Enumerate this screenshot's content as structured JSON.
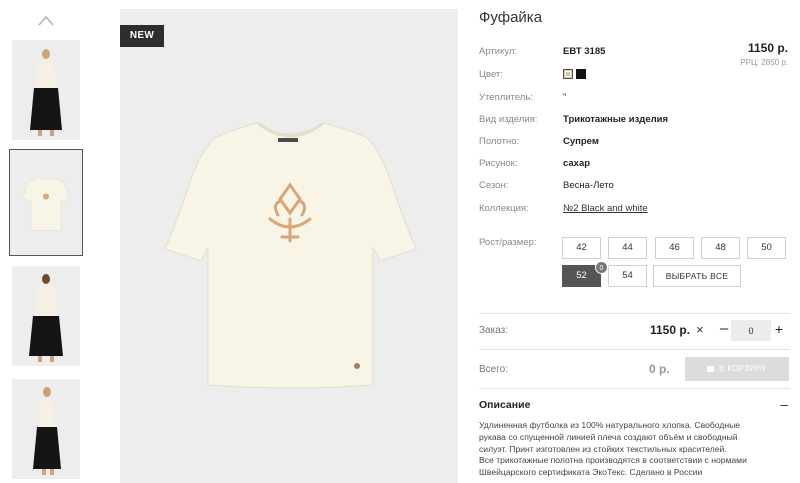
{
  "badge": "NEW",
  "product": {
    "title": "Фуфайка",
    "price": "1150 р.",
    "rrp": "РРЦ: 2850 р."
  },
  "attributes": [
    {
      "label": "Артикул:",
      "value": "ЕВТ 3185"
    },
    {
      "label": "Цвет:",
      "value": ""
    },
    {
      "label": "Утеплитель:",
      "value": "\""
    },
    {
      "label": "Вид изделия:",
      "value": "Трикотажные изделия"
    },
    {
      "label": "Полотно:",
      "value": "Супрем"
    },
    {
      "label": "Рисунок:",
      "value": "сахар"
    },
    {
      "label": "Сезон:",
      "value": "Весна-Лето"
    },
    {
      "label": "Коллекция:",
      "value": "№2 Black and white"
    }
  ],
  "colors": {
    "swatches": [
      "#d7c8a8",
      "#111111"
    ],
    "accent_dark": "#555555",
    "cart_disabled": "#dcdcdc"
  },
  "sizes": {
    "label": "Рост/размер:",
    "options": [
      "42",
      "44",
      "46",
      "48",
      "50",
      "52",
      "54"
    ],
    "selected": "52",
    "selected_count": "0",
    "select_all": "ВЫБРАТЬ ВСЕ"
  },
  "order": {
    "label": "Заказ:",
    "price": "1150 р.",
    "times": "×",
    "minus": "–",
    "quantity": "0",
    "plus": "+"
  },
  "total": {
    "label": "Всего:",
    "value": "0 р.",
    "cart_button": "В КОРЗИНУ"
  },
  "description": {
    "title": "Описание",
    "toggle": "–",
    "lines": [
      "Удлиненная футболка из 100% натурального хлопка. Свободные",
      "рукава со спущенной линией плеча создают объём и свободный",
      "силуэт. Принт изготовлен из стойких текстильных красителей.",
      "Все трикотажные полотна производятся в соответствии с нормами",
      "Швейцарского сертификата ЭкоТекс. Сделано в России"
    ]
  },
  "icons": {
    "thumb_up": "chevron-up-icon",
    "cart": "cart-icon"
  }
}
